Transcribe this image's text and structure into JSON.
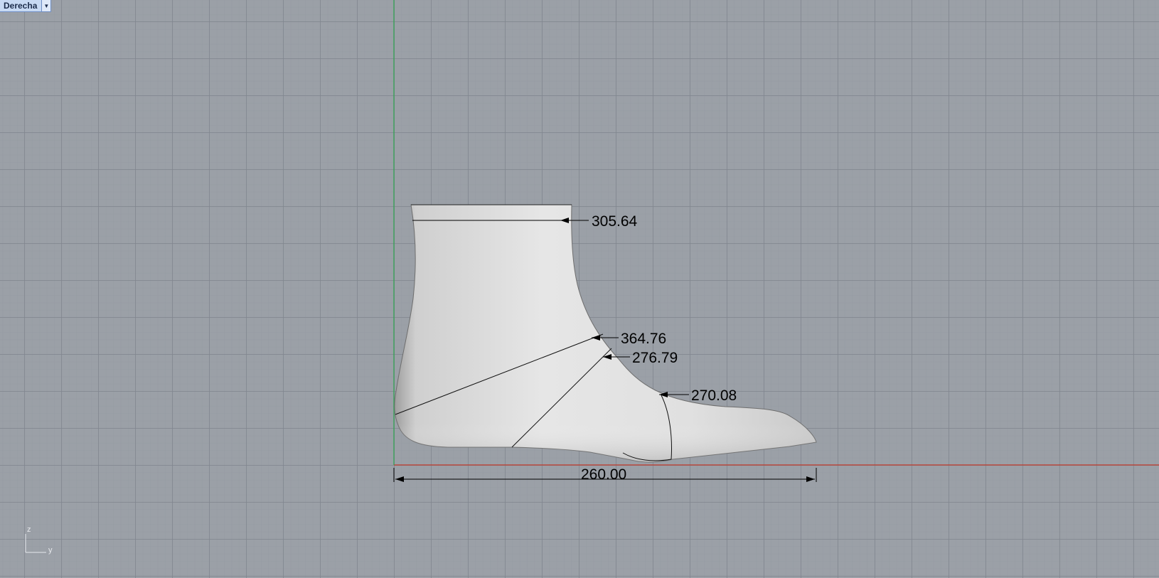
{
  "viewport": {
    "name": "Derecha",
    "dropdown_icon": "triangle-down-icon"
  },
  "dimensions": {
    "top_circumference": "305.64",
    "instep_diagonal": "364.76",
    "instep": "276.79",
    "ball": "270.08",
    "length": "260.00"
  },
  "axis_triad": {
    "vertical": "z",
    "horizontal": "y"
  },
  "colors": {
    "viewport_background": "#9ba0a7",
    "grid_line": "#80858e",
    "x_axis": "#c0392b",
    "y_axis": "#2ea44f",
    "model_surface": "#e2e2e2",
    "dimension": "#000000",
    "viewport_tab": "#c7d9f3"
  }
}
